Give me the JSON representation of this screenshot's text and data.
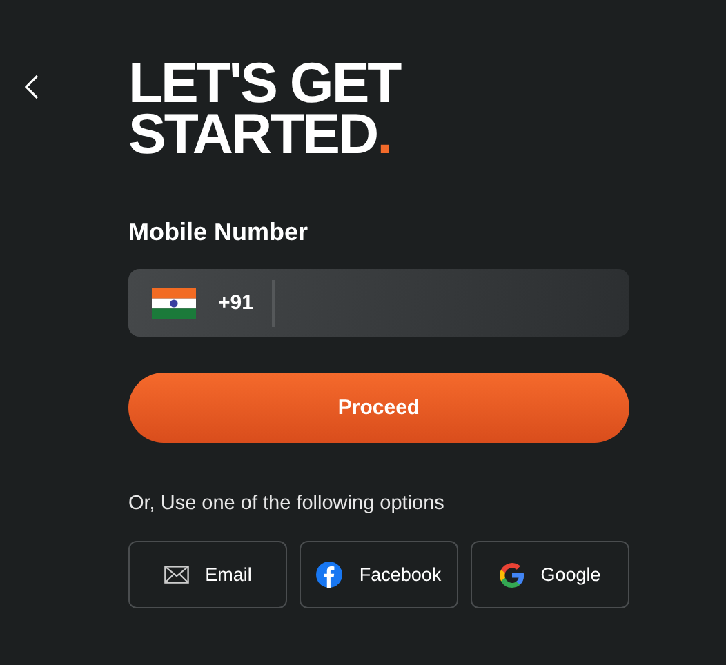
{
  "title": {
    "lines": [
      "LET'S GET",
      "STARTED"
    ],
    "accent": "."
  },
  "mobile_number": {
    "label": "Mobile Number",
    "country_code": "+91"
  },
  "proceed_button": {
    "label": "Proceed"
  },
  "options_text": "Or, Use one of the following options",
  "options": [
    {
      "kind": "email",
      "label": "Email"
    },
    {
      "kind": "facebook",
      "label": "Facebook"
    },
    {
      "kind": "google",
      "label": "Google"
    }
  ]
}
